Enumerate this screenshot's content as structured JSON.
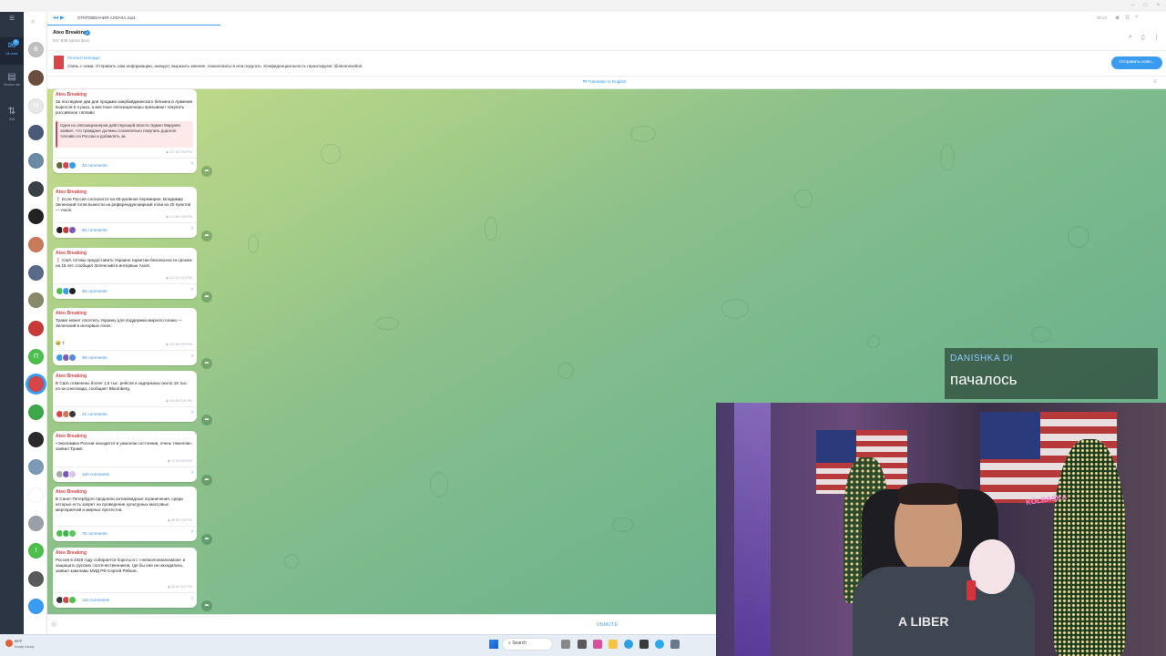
{
  "window": {
    "media_title": "ОТКРОВЕННИЯ АЛЛАХА.mp3",
    "media_time": "00:21"
  },
  "folders": [
    {
      "label": "All chats",
      "badge": "9",
      "icon": "chat-bubble-icon"
    },
    {
      "label": "Личное чат",
      "badge": "",
      "icon": "folder-icon"
    },
    {
      "label": "Edit",
      "badge": "",
      "icon": "edit-folders-icon"
    }
  ],
  "chat_list_avatars": [
    {
      "letter": "B",
      "color": "#bfbfbf"
    },
    {
      "letter": "",
      "color": "#6b4e3d"
    },
    {
      "letter": "M",
      "color": "#e8e8e8"
    },
    {
      "letter": "",
      "color": "#4a5a7a"
    },
    {
      "letter": "",
      "color": "#6a8aa8"
    },
    {
      "letter": "",
      "color": "#3a4048"
    },
    {
      "letter": "",
      "color": "#222222"
    },
    {
      "letter": "",
      "color": "#c87a5a"
    },
    {
      "letter": "",
      "color": "#5a6a8a"
    },
    {
      "letter": "",
      "color": "#8a8a6a"
    },
    {
      "letter": "",
      "color": "#c83a3a"
    },
    {
      "letter": "П",
      "color": "#4cbf4c"
    },
    {
      "letter": "",
      "color": "#d6454a"
    },
    {
      "letter": "",
      "color": "#3ca84a"
    },
    {
      "letter": "",
      "color": "#2a2a2a"
    },
    {
      "letter": "",
      "color": "#7a9ab8"
    },
    {
      "letter": "",
      "color": "#ffffff"
    },
    {
      "letter": "",
      "color": "#9aa0a8"
    },
    {
      "letter": "I",
      "color": "#4cbf4c"
    },
    {
      "letter": "",
      "color": "#5a5a5a"
    },
    {
      "letter": "",
      "color": "#3a9cf0"
    }
  ],
  "header": {
    "channel_name": "Ateo Breaking",
    "subscribers": "947 839 subscribers"
  },
  "pinned": {
    "title": "Pinned message",
    "text": "Связь с нами. Отправить нам информацию, анекдот, выразить мнение, пожаловаться или поругать. Конфиденциальность гарантируем: @ateonewsbot",
    "button": "Отправить ново..."
  },
  "translate_label": "Translate to English",
  "posts": [
    {
      "channel": "Ateo Breaking",
      "text": "За последние два дня продажи азербайджанского бензина в Армении выросли в 4 раза, а местные оппозиционеры призывают покупать российское топливо",
      "quote": "Одна из оппозиционеров действующей власти Эдмон Марукян заявил, что граждане должны сознательно покупать дорогое топливо из России и добавлять за",
      "meta": "127.6K  3:59 PM",
      "comments": "43 comments"
    },
    {
      "channel": "Ateo Breaking",
      "text": "❗ Если Россия согласится на 60-дневное перемирие, Владимир Зеленский готов вынести на референдум мирный план из 20 пунктов — Axios.",
      "meta": "112.8K  4:03 PM",
      "comments": "65 comments"
    },
    {
      "channel": "Ateo Breaking",
      "text": "❗ США готовы предоставить Украине гарантии безопасности сроком на 15 лет, сообщил Зеленский в интервью Axios.",
      "meta": "112.1K  4:18 PM",
      "comments": "66 comments"
    },
    {
      "channel": "Ateo Breaking",
      "text": "Трамп может посетить Украину для поддержки мирного плана — Зеленский в интервью Axios.",
      "reaction": "😂 7",
      "meta": "103.8K  5:00 PM",
      "comments": "96 comments"
    },
    {
      "channel": "Ateo Breaking",
      "text": "В США отменены более 1,6 тыс. рейсов и задержаны около 19 тыс. из-за снегопада, сообщает Bloomberg.",
      "meta": "100.6K  5:25 PM",
      "comments": "21 comments"
    },
    {
      "channel": "Ateo Breaking",
      "text": "«Экономика России находится в ужасном состоянии, очень тяжелом», заявил Трамп.",
      "meta": "72.1K  5:30 PM",
      "comments": "125 comments"
    },
    {
      "channel": "Ateo Breaking",
      "text": "В Санкт-Петербурге продлили антиковидные ограничения, среди которых есть запрет на проведение культурных массовых мероприятий и мирных протестов.",
      "meta": "68.0K  5:33 PM",
      "comments": "75 comments"
    },
    {
      "channel": "Ateo Breaking",
      "text": "Россия в 2026 году собирается бороться с «неоколониализмом» и защищать русских соотечественников, где бы они ни находились, заявил замглавы МИД РФ Сергей Рябков.",
      "meta": "25.4K  5:47 PM",
      "comments": "122 comments"
    }
  ],
  "bottom": {
    "unmute": "UNMUTE"
  },
  "overlay": {
    "username": "DANISHKA DI",
    "message": "пачалось"
  },
  "webcam": {
    "neon_sign": "KOLBASKA"
  },
  "taskbar": {
    "weather_temp": "55°F",
    "weather_desc": "Mostly cloudy",
    "search": "Search"
  },
  "colors": {
    "accent": "#3a9cf0",
    "channel_name": "#d6454a",
    "sidebar": "#2b3443"
  }
}
